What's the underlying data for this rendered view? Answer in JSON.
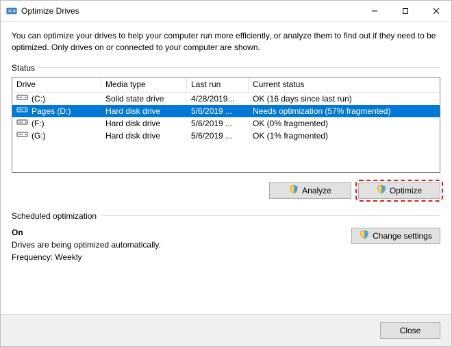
{
  "window": {
    "title": "Optimize Drives"
  },
  "intro": "You can optimize your drives to help your computer run more efficiently, or analyze them to find out if they need to be optimized. Only drives on or connected to your computer are shown.",
  "status_label": "Status",
  "columns": {
    "drive": "Drive",
    "media": "Media type",
    "last_run": "Last run",
    "current": "Current status"
  },
  "rows": [
    {
      "icon": "ssd",
      "drive": "(C:)",
      "media": "Solid state drive",
      "last_run": "4/28/2019...",
      "status": "OK (16 days since last run)",
      "selected": false
    },
    {
      "icon": "hdd",
      "drive": "Pages (D:)",
      "media": "Hard disk drive",
      "last_run": "5/6/2019 ...",
      "status": "Needs optimization (57% fragmented)",
      "selected": true
    },
    {
      "icon": "hdd",
      "drive": "(F:)",
      "media": "Hard disk drive",
      "last_run": "5/6/2019 ...",
      "status": "OK (0% fragmented)",
      "selected": false
    },
    {
      "icon": "hdd",
      "drive": "(G:)",
      "media": "Hard disk drive",
      "last_run": "5/6/2019 ...",
      "status": "OK (1% fragmented)",
      "selected": false
    }
  ],
  "buttons": {
    "analyze": "Analyze",
    "optimize": "Optimize",
    "change_settings": "Change settings",
    "close": "Close"
  },
  "scheduled": {
    "label": "Scheduled optimization",
    "state": "On",
    "desc": "Drives are being optimized automatically.",
    "freq": "Frequency: Weekly"
  }
}
